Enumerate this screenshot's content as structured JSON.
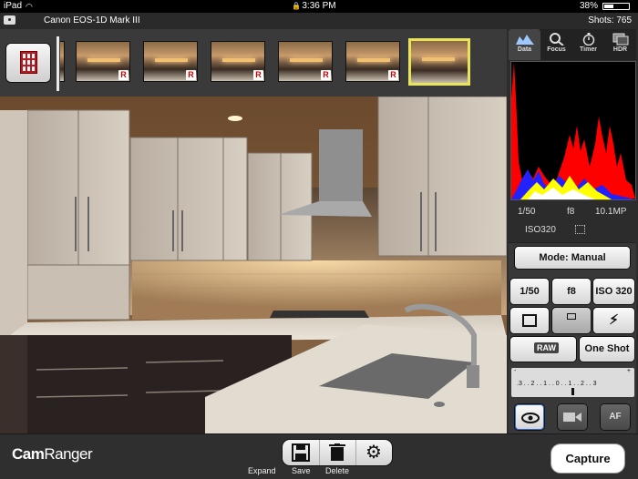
{
  "status_bar": {
    "carrier": "iPad",
    "time": "3:36 PM",
    "battery": "38%"
  },
  "camera_header": {
    "camera_name": "Canon EOS-1D Mark III",
    "shots": "Shots: 765"
  },
  "thumbnails": [
    {
      "badge": "R"
    },
    {
      "badge": "R"
    },
    {
      "badge": "R"
    },
    {
      "badge": "R"
    },
    {
      "badge": "R"
    },
    {
      "badge": ""
    }
  ],
  "tabs": {
    "data": "Data",
    "focus": "Focus",
    "timer": "Timer",
    "hdr": "HDR"
  },
  "exposure": {
    "shutter": "1/50",
    "aperture": "f8",
    "resolution": "10.1MP",
    "iso": "ISO320"
  },
  "controls": {
    "mode": "Mode: Manual",
    "shutter": "1/50",
    "aperture": "f8",
    "iso": "ISO 320",
    "raw": "RAW",
    "drive": "One Shot",
    "ruler_minus": "-",
    "ruler_plus": "+",
    "ruler_scale": ".3 . . 2 . . 1 . . 0 . . 1 . . 2 . . 3",
    "af": "AF"
  },
  "bottom": {
    "logo_bold": "Cam",
    "logo_light": "Ranger",
    "expand": "Expand",
    "save": "Save",
    "delete": "Delete",
    "capture": "Capture"
  },
  "colors": {
    "accent_selected": "#e8e35a",
    "raw_badge": "#cc0000",
    "histogram_red": "#ff0000",
    "histogram_blue": "#2222ff",
    "histogram_yellow": "#ffff00"
  }
}
